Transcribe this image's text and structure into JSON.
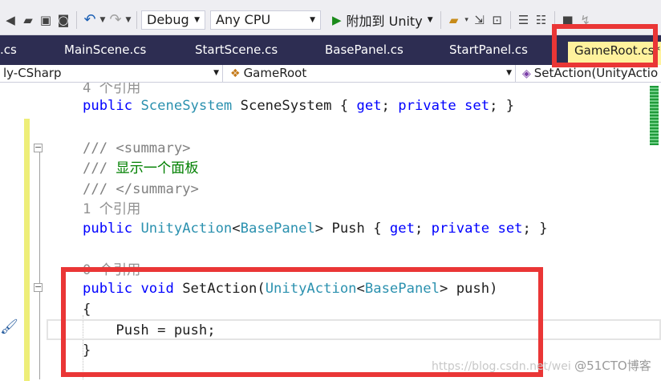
{
  "toolbar": {
    "configuration": "Debug",
    "platform": "Any CPU",
    "attach_label": "附加到 Unity"
  },
  "tabs": [
    {
      "label": ".cs"
    },
    {
      "label": "MainScene.cs"
    },
    {
      "label": "StartScene.cs"
    },
    {
      "label": "BasePanel.cs"
    },
    {
      "label": "StartPanel.cs"
    },
    {
      "label": "GameRoot.cs*"
    }
  ],
  "navbar": {
    "project": "ly-CSharp",
    "type": "GameRoot",
    "member": "SetAction(UnityActio"
  },
  "code": {
    "ref_4": "4 个引用",
    "public": "public",
    "t_scene_system": "SceneSystem",
    "prop_scene_system": " SceneSystem { ",
    "get": "get",
    "semi": "; ",
    "private": "private",
    "set": "set",
    "close_brace_end": "; }",
    "doc_prefix": "///",
    "summary_open": " <summary>",
    "summary_text": " 显示一个面板",
    "summary_close": " </summary>",
    "ref_1": "1 个引用",
    "t_unity_action": "UnityAction",
    "lt": "<",
    "t_base_panel": "BasePanel",
    "gt_push": "> Push { ",
    "ref_0": "0 个引用",
    "void": "void",
    "set_action_name": " SetAction(",
    "param_tail": "> push)",
    "open_brace": "{",
    "body": "    Push = push;",
    "close_brace": "}"
  },
  "watermark": {
    "url": "https://blog.csdn.net/wei",
    "brand": "@51CTO博客"
  },
  "colors": {
    "keyword": "#0000ff",
    "type": "#2b91af",
    "comment": "#008000",
    "annotation_red": "#ea3636",
    "active_tab": "#fff29d",
    "tab_bar": "#2d2d52"
  }
}
